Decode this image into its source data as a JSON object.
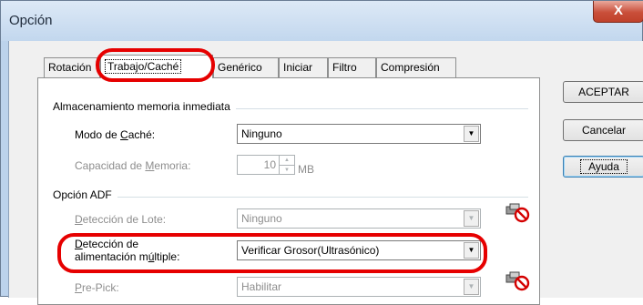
{
  "window": {
    "title": "Opción",
    "close_glyph": "X"
  },
  "tabs": [
    {
      "label": "Rotación"
    },
    {
      "label": "Trabajo/Caché"
    },
    {
      "label": "Genérico"
    },
    {
      "label": "Iniciar"
    },
    {
      "label": "Filtro"
    },
    {
      "label": "Compresión"
    }
  ],
  "cache_group": {
    "title": "Almacenamiento memoria inmediata",
    "mode_label_pre": "Modo de ",
    "mode_label_u": "C",
    "mode_label_post": "aché:",
    "mode_value": "Ninguno",
    "capacity_label_pre": "Capacidad de ",
    "capacity_label_u": "M",
    "capacity_label_post": "emoria:",
    "capacity_value": "10",
    "capacity_unit": "MB"
  },
  "adf_group": {
    "title": "Opción ADF",
    "batch_label_u": "D",
    "batch_label_post": "etección de Lote:",
    "batch_value": "Ninguno",
    "multifeed_label_line1_u": "D",
    "multifeed_label_line1_post": "etección de",
    "multifeed_label_line2_pre": "alimentación m",
    "multifeed_label_line2_u": "ú",
    "multifeed_label_line2_post": "ltiple:",
    "multifeed_value": "Verificar Grosor(Ultrasónico)",
    "prepick_label_u": "P",
    "prepick_label_post": "re-Pick:",
    "prepick_value": "Habilitar"
  },
  "buttons": {
    "ok": "ACEPTAR",
    "cancel": "Cancelar",
    "help": "Ayuda"
  },
  "icons": {
    "dropdown": "chevron-down-icon",
    "disabled_config": "no-setting-icon",
    "highlight_color": "#e60000"
  }
}
